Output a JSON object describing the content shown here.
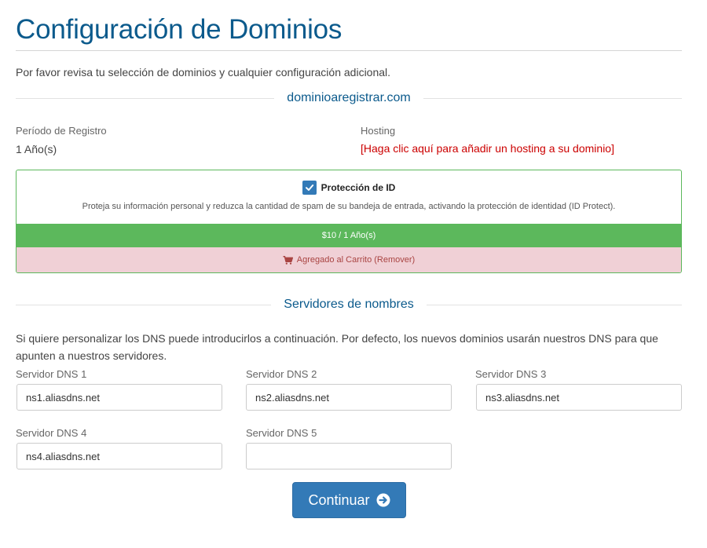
{
  "page": {
    "title": "Configuración de Dominios",
    "intro": "Por favor revisa tu selección de dominios y cualquier configuración adicional."
  },
  "domain": {
    "name": "dominioaregistrar.com",
    "period_label": "Período de Registro",
    "period_value": "1 Año(s)",
    "hosting_label": "Hosting",
    "hosting_link": "[Haga clic aquí para añadir un hosting a su dominio]"
  },
  "addon": {
    "checked": true,
    "title": "Protección de ID",
    "description": "Proteja su información personal y reduzca la cantidad de spam de su bandeja de entrada, activando la protección de identidad (ID Protect).",
    "price": "$10 / 1 Año(s)",
    "cart_status": "Agregado al Carrito (Remover)",
    "icons": {
      "checkbox": "check-icon",
      "cart": "shopping-cart-icon"
    }
  },
  "nameservers": {
    "heading": "Servidores de nombres",
    "intro": "Si quiere personalizar los DNS puede introducirlos a continuación. Por defecto, los nuevos dominios usarán nuestros DNS para que apunten a nuestros servidores.",
    "fields": [
      {
        "label": "Servidor DNS 1",
        "value": "ns1.aliasdns.net"
      },
      {
        "label": "Servidor DNS 2",
        "value": "ns2.aliasdns.net"
      },
      {
        "label": "Servidor DNS 3",
        "value": "ns3.aliasdns.net"
      },
      {
        "label": "Servidor DNS 4",
        "value": "ns4.aliasdns.net"
      },
      {
        "label": "Servidor DNS 5",
        "value": ""
      }
    ]
  },
  "actions": {
    "continue_label": "Continuar",
    "continue_icon": "arrow-circle-right-icon"
  },
  "colors": {
    "accent": "#0b5a8c",
    "primary_button": "#337ab7",
    "success": "#5cb85c",
    "danger_bg": "#f0d0d6",
    "danger_text": "#a94442",
    "link_red": "#cc0000"
  }
}
